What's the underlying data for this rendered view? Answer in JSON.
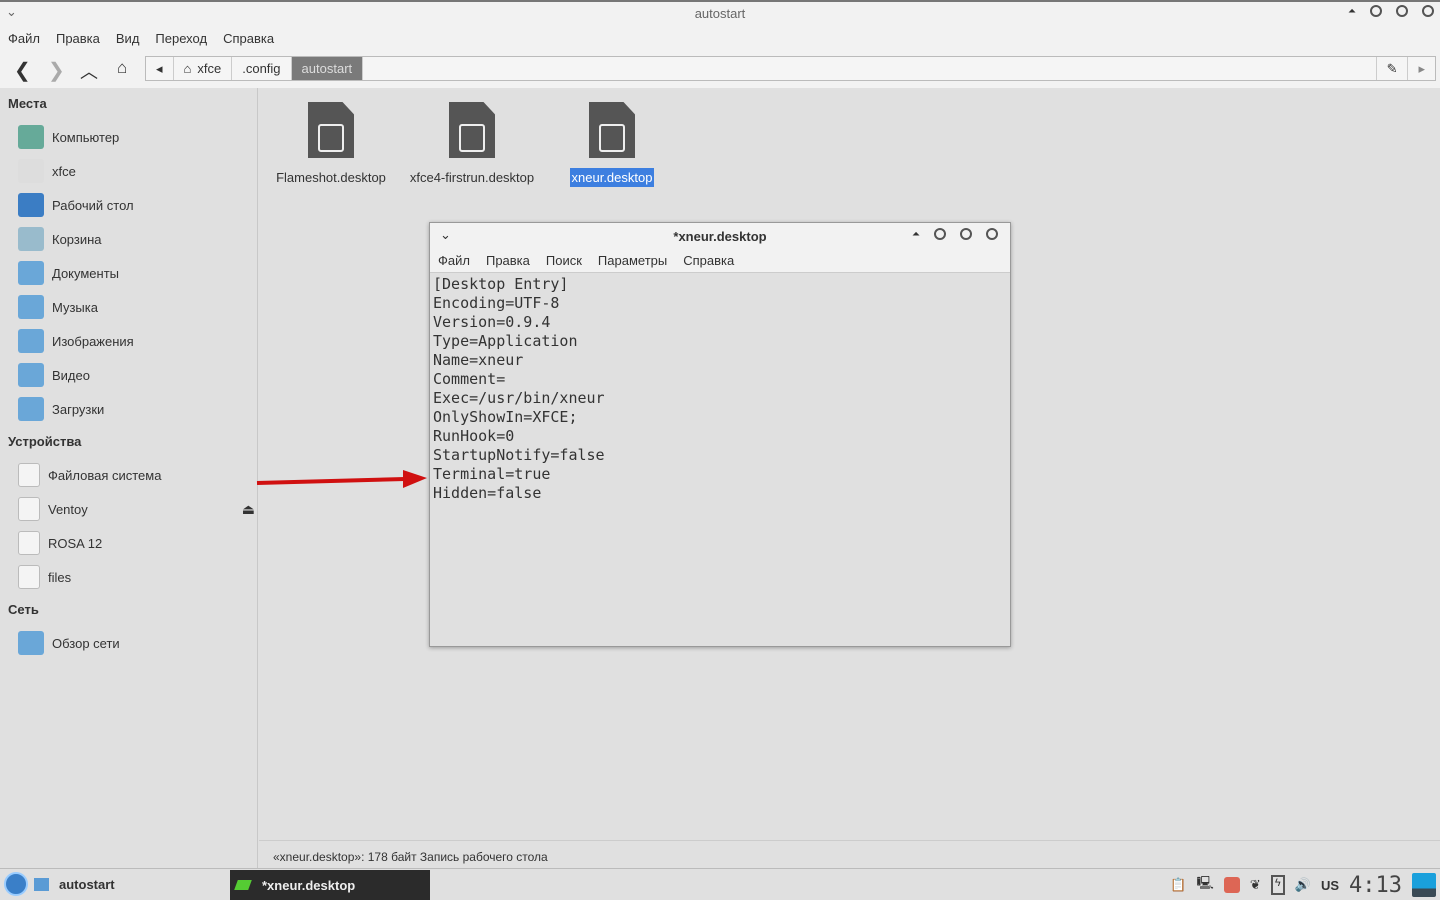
{
  "window": {
    "title": "autostart"
  },
  "menu": [
    "Файл",
    "Правка",
    "Вид",
    "Переход",
    "Справка"
  ],
  "path": {
    "segments": [
      "xfce",
      ".config",
      "autostart"
    ]
  },
  "sidebar": {
    "places_header": "Места",
    "places": [
      {
        "label": "Компьютер",
        "icon": "computer-icon",
        "color": "#6a9"
      },
      {
        "label": "xfce",
        "icon": "home-icon",
        "color": "#ddd"
      },
      {
        "label": "Рабочий стол",
        "icon": "desktop-icon",
        "color": "#3b7dc4"
      },
      {
        "label": "Корзина",
        "icon": "trash-icon",
        "color": "#9bc"
      },
      {
        "label": "Документы",
        "icon": "documents-folder-icon",
        "color": "#6aa7d8"
      },
      {
        "label": "Музыка",
        "icon": "music-folder-icon",
        "color": "#6aa7d8"
      },
      {
        "label": "Изображения",
        "icon": "pictures-folder-icon",
        "color": "#6aa7d8"
      },
      {
        "label": "Видео",
        "icon": "videos-folder-icon",
        "color": "#6aa7d8"
      },
      {
        "label": "Загрузки",
        "icon": "downloads-folder-icon",
        "color": "#6aa7d8"
      }
    ],
    "devices_header": "Устройства",
    "devices": [
      {
        "label": "Файловая система"
      },
      {
        "label": "Ventoy",
        "eject": true
      },
      {
        "label": "ROSA 12"
      },
      {
        "label": "files"
      }
    ],
    "network_header": "Сеть",
    "network": [
      {
        "label": "Обзор сети"
      }
    ]
  },
  "files": [
    {
      "name": "Flameshot.desktop"
    },
    {
      "name": "xfce4-firstrun.desktop"
    },
    {
      "name": "xneur.desktop",
      "selected": true
    }
  ],
  "status": "«xneur.desktop»: 178 байт Запись рабочего стола",
  "editor": {
    "title": "*xneur.desktop",
    "menu": [
      "Файл",
      "Правка",
      "Поиск",
      "Параметры",
      "Справка"
    ],
    "lines": [
      "[Desktop Entry]",
      "Encoding=UTF-8",
      "Version=0.9.4",
      "Type=Application",
      "Name=xneur",
      "Comment=",
      "Exec=/usr/bin/xneur",
      "OnlyShowIn=XFCE;",
      "RunHook=0",
      "StartupNotify=false",
      "Terminal=true",
      "Hidden=false"
    ]
  },
  "taskbar": {
    "tasks": [
      "autostart",
      "*xneur.desktop"
    ],
    "keyboard": "US",
    "clock": "4:13"
  },
  "colors": {
    "accent": "#3d7fe0",
    "arrow": "#d01010"
  }
}
